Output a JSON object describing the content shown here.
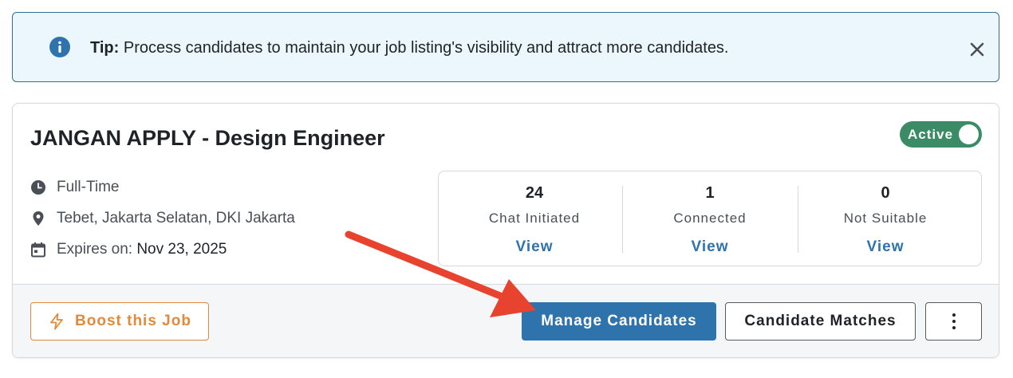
{
  "tip": {
    "bold_label": "Tip:",
    "message": "Process candidates to maintain your job listing's visibility and attract more candidates.",
    "icons": {
      "info": "info-icon",
      "close": "close-icon"
    }
  },
  "job": {
    "title": "JANGAN APPLY - Design Engineer",
    "status_label": "Active",
    "status_on": true,
    "employment_type": "Full-Time",
    "location": "Tebet, Jakarta Selatan, DKI Jakarta",
    "expires_label": "Expires on:",
    "expires_date": "Nov 23, 2025"
  },
  "stats": [
    {
      "count": "24",
      "label": "Chat Initiated",
      "action": "View"
    },
    {
      "count": "1",
      "label": "Connected",
      "action": "View"
    },
    {
      "count": "0",
      "label": "Not Suitable",
      "action": "View"
    }
  ],
  "actions": {
    "boost_label": "Boost this Job",
    "manage_label": "Manage Candidates",
    "matches_label": "Candidate Matches"
  },
  "colors": {
    "tip_background": "#ebf7fc",
    "tip_border": "#2f6f8f",
    "accent_blue": "#2f73ad",
    "active_green": "#3a8b66",
    "boost_orange": "#e08a3c",
    "annotation_arrow": "#e8432e"
  }
}
